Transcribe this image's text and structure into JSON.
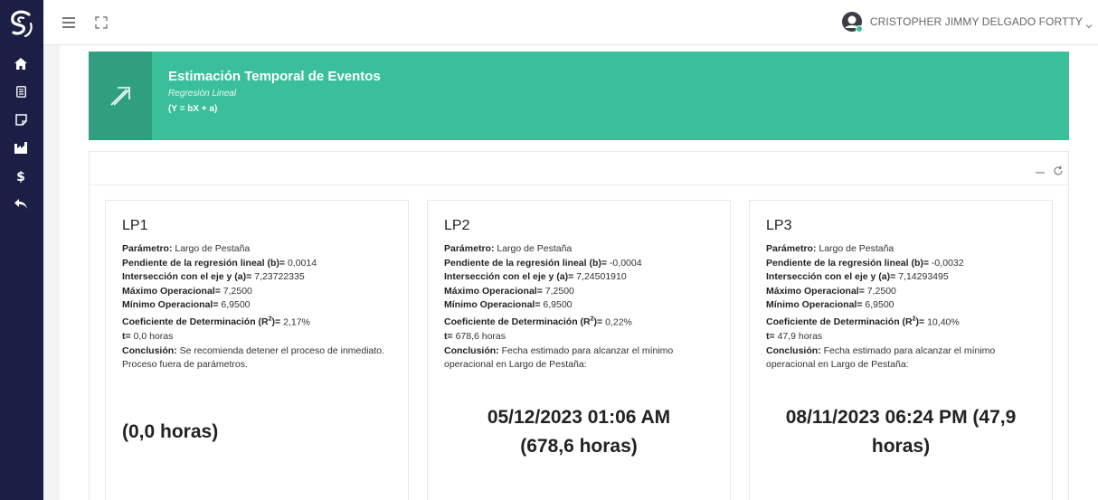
{
  "user": {
    "name": "CRISTOPHER JIMMY DELGADO FORTTY"
  },
  "banner": {
    "title": "Estimación Temporal de Eventos",
    "subtitle": "Regresión Lineal",
    "formula": "(Y = bX + a)"
  },
  "labels": {
    "parametro": "Parámetro:",
    "pendiente": "Pendiente de la regresión lineal (b)=",
    "interseccion": "Intersección con el eje y (a)=",
    "maximo": "Máximo Operacional=",
    "minimo": "Mínimo Operacional=",
    "coeficiente_pre": "Coeficiente de Determinación (R",
    "coeficiente_sup": "2",
    "coeficiente_post": ")=",
    "t": "t=",
    "conclusion": "Conclusión:"
  },
  "cards": [
    {
      "title": "LP1",
      "parametro": "Largo de Pestaña",
      "pendiente": "0,0014",
      "interseccion": "7,23722335",
      "maximo": "7,2500",
      "minimo": "6,9500",
      "coeficiente": "2,17%",
      "t": "0,0 horas",
      "conclusion": "Se recomienda detener el proceso de inmediato. Proceso fuera de parámetros.",
      "result_line1": "(0,0 horas)",
      "result_line2": ""
    },
    {
      "title": "LP2",
      "parametro": "Largo de Pestaña",
      "pendiente": "-0,0004",
      "interseccion": "7,24501910",
      "maximo": "7,2500",
      "minimo": "6,9500",
      "coeficiente": "0,22%",
      "t": "678,6 horas",
      "conclusion": "Fecha estimado para alcanzar el mínimo operacional en Largo de Pestaña:",
      "result_line1": "05/12/2023 01:06 AM",
      "result_line2": "(678,6 horas)"
    },
    {
      "title": "LP3",
      "parametro": "Largo de Pestaña",
      "pendiente": "-0,0032",
      "interseccion": "7,14293495",
      "maximo": "7,2500",
      "minimo": "6,9500",
      "coeficiente": "10,40%",
      "t": "47,9 horas",
      "conclusion": "Fecha estimado para alcanzar el mínimo operacional en Largo de Pestaña:",
      "result_line1": "08/11/2023 06:24 PM (47,9",
      "result_line2": "horas)"
    }
  ],
  "icons": {
    "logo": "brand-logo-icon",
    "nav": [
      "home-icon",
      "document-icon",
      "note-icon",
      "factory-icon",
      "dollar-icon",
      "back-arrow-icon"
    ],
    "banner": "arrow-up-right-icon",
    "tools": [
      "minimize-icon",
      "refresh-icon"
    ]
  },
  "colors": {
    "sidebar": "#1b1f45",
    "banner": "#3bbf9b",
    "banner_icon_box": "#2f9f80"
  }
}
